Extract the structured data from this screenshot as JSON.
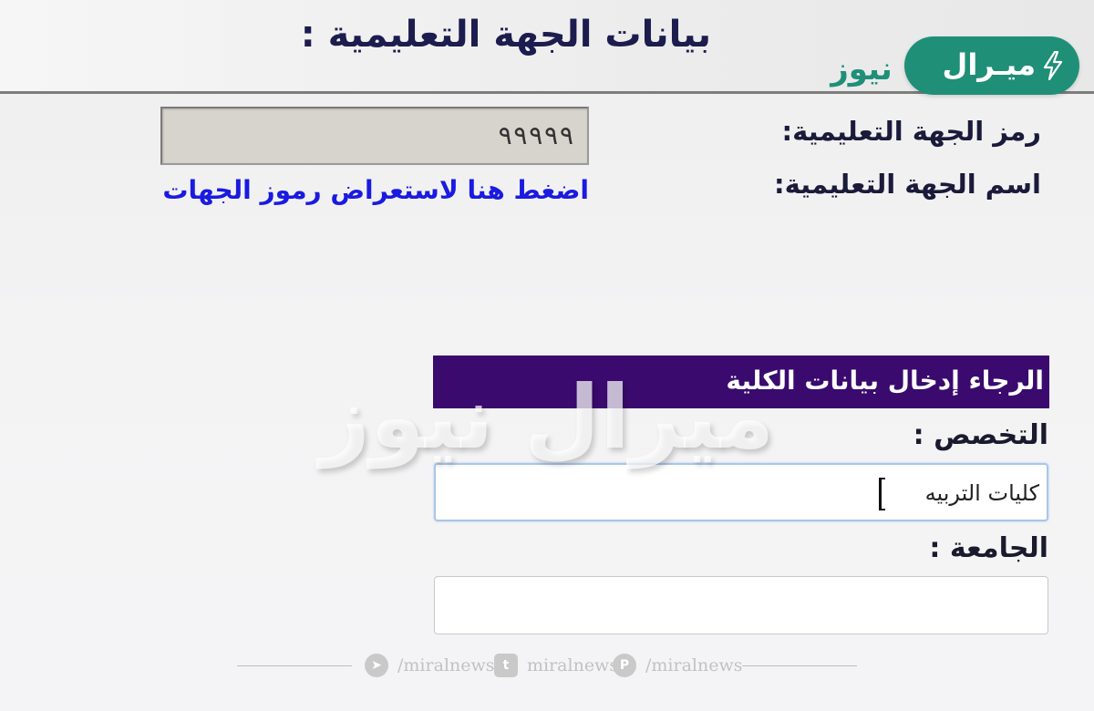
{
  "header": {
    "section_title": "بيانات الجهة التعليمية :"
  },
  "brand": {
    "badge_text": "ميـرال",
    "sub_text": "نيوز",
    "color": "#1f8f78"
  },
  "institution": {
    "code_label": "رمز الجهة التعليمية:",
    "code_value": "٩٩٩٩٩",
    "name_label": "اسم الجهة التعليمية:",
    "codes_link": "اضغط هنا لاستعراض رموز الجهات",
    "link_color": "#1a1ae0"
  },
  "college_form": {
    "header": "الرجاء إدخال بيانات الكلية",
    "header_color": "#3a0a6e",
    "specialization_label": "التخصص :",
    "specialization_value": "كليات التربيه",
    "university_label": "الجامعة :",
    "university_value": ""
  },
  "watermark": {
    "text": "ميرال نيوز"
  },
  "footer": {
    "items": [
      {
        "icon": "telegram-icon",
        "text": "/miralnews"
      },
      {
        "icon": "twitter-icon",
        "text": "miralnews"
      },
      {
        "icon": "pinterest-icon",
        "text": "/miralnews"
      }
    ]
  }
}
